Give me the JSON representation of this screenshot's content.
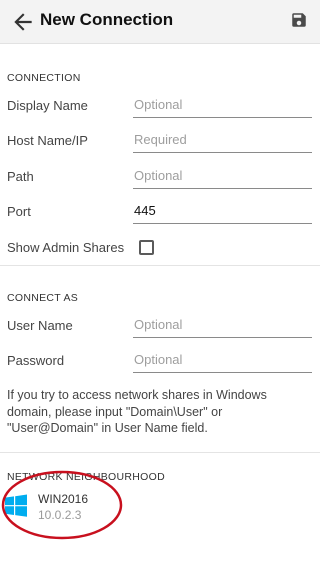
{
  "app_bar": {
    "title": "New Connection",
    "back_icon": "arrow-left-icon",
    "save_icon": "floppy-save-icon"
  },
  "connection_section": {
    "header": "CONNECTION",
    "display_name": {
      "label": "Display Name",
      "value": "",
      "placeholder": "Optional"
    },
    "host": {
      "label": "Host Name/IP",
      "value": "",
      "placeholder": "Required"
    },
    "path": {
      "label": "Path",
      "value": "",
      "placeholder": "Optional"
    },
    "port": {
      "label": "Port",
      "value": "445",
      "placeholder": ""
    },
    "show_admin_shares": {
      "label": "Show Admin Shares",
      "checked": false
    }
  },
  "connect_as_section": {
    "header": "CONNECT AS",
    "user_name": {
      "label": "User Name",
      "value": "",
      "placeholder": "Optional"
    },
    "password": {
      "label": "Password",
      "value": "",
      "placeholder": "Optional"
    },
    "help": "If you try to access network shares in Windows domain, please input \"Domain\\User\" or \"User@Domain\" in User Name field."
  },
  "network_section": {
    "header": "NETWORK NEIGHBOURHOOD",
    "items": [
      {
        "name": "WIN2016",
        "address": "10.0.2.3",
        "icon": "windows-logo-icon"
      }
    ]
  },
  "colors": {
    "app_bar_bg": "#f3f3f3",
    "windows_blue": "#00adef",
    "annotation_red": "#c8101e",
    "underline": "#8a8a8a"
  }
}
